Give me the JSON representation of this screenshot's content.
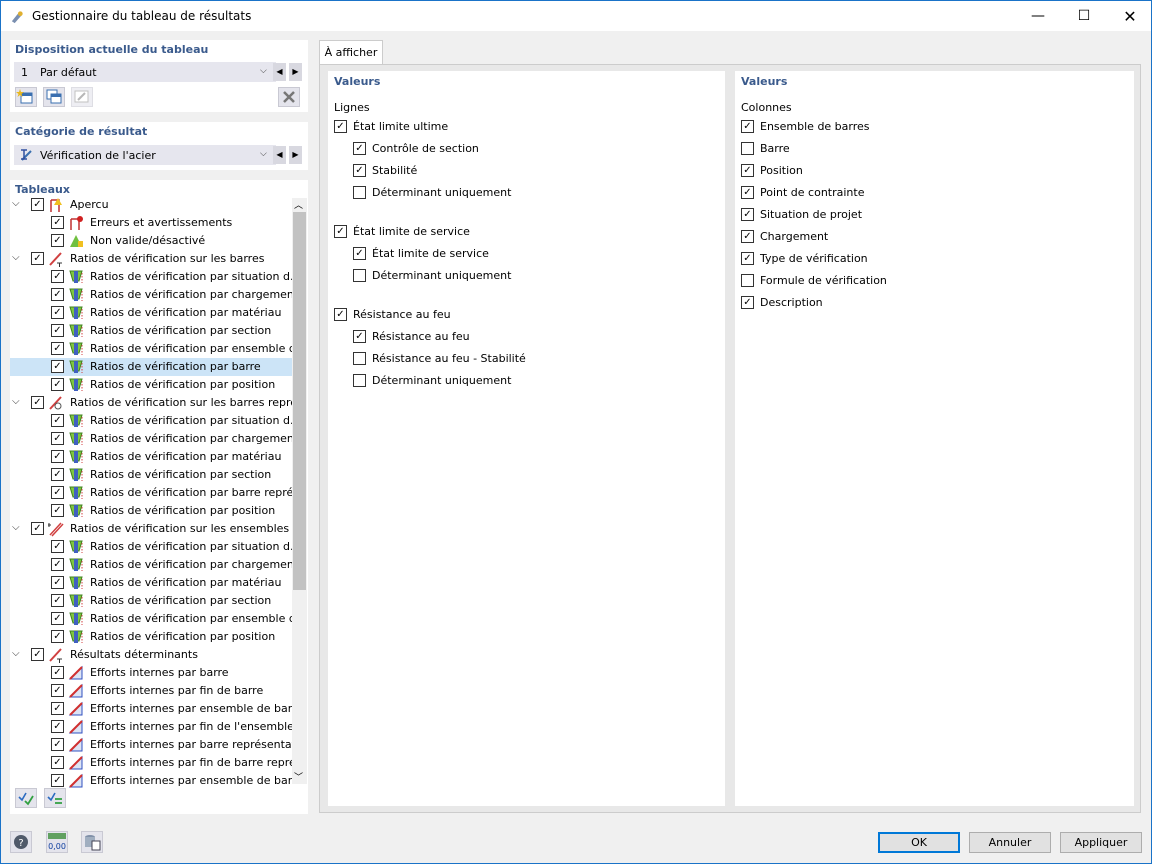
{
  "window": {
    "title": "Gestionnaire du tableau de résultats"
  },
  "layout_panel": {
    "title": "Disposition actuelle du tableau",
    "number": "1",
    "value": "Par défaut"
  },
  "category_panel": {
    "title": "Catégorie de résultat",
    "value": "Vérification de l'acier"
  },
  "tables_panel": {
    "title": "Tableaux",
    "rows": [
      {
        "label": "Apercu",
        "level": 0,
        "expanded": true,
        "checked": true,
        "icon": "overview-icon"
      },
      {
        "label": "Erreurs et avertissements",
        "level": 1,
        "checked": true,
        "icon": "error-icon"
      },
      {
        "label": "Non valide/désactivé",
        "level": 1,
        "checked": true,
        "icon": "warning-icon"
      },
      {
        "label": "Ratios de vérification sur les barres",
        "level": 0,
        "expanded": true,
        "checked": true,
        "icon": "member-icon"
      },
      {
        "label": "Ratios de vérification par situation d...",
        "level": 1,
        "checked": true,
        "icon": "ratio-icon"
      },
      {
        "label": "Ratios de vérification par chargement",
        "level": 1,
        "checked": true,
        "icon": "ratio-icon"
      },
      {
        "label": "Ratios de vérification par matériau",
        "level": 1,
        "checked": true,
        "icon": "ratio-icon"
      },
      {
        "label": "Ratios de vérification par section",
        "level": 1,
        "checked": true,
        "icon": "ratio-icon"
      },
      {
        "label": "Ratios de vérification par ensemble d...",
        "level": 1,
        "checked": true,
        "icon": "ratio-icon"
      },
      {
        "label": "Ratios de vérification par barre",
        "level": 1,
        "checked": true,
        "icon": "ratio-icon",
        "selected": true
      },
      {
        "label": "Ratios de vérification par position",
        "level": 1,
        "checked": true,
        "icon": "ratio-icon"
      },
      {
        "label": "Ratios de vérification sur les barres repré...",
        "level": 0,
        "expanded": true,
        "checked": true,
        "icon": "rep-member-icon"
      },
      {
        "label": "Ratios de vérification par situation d...",
        "level": 1,
        "checked": true,
        "icon": "ratio-icon"
      },
      {
        "label": "Ratios de vérification par chargement",
        "level": 1,
        "checked": true,
        "icon": "ratio-icon"
      },
      {
        "label": "Ratios de vérification par matériau",
        "level": 1,
        "checked": true,
        "icon": "ratio-icon"
      },
      {
        "label": "Ratios de vérification par section",
        "level": 1,
        "checked": true,
        "icon": "ratio-icon"
      },
      {
        "label": "Ratios de vérification par barre repré...",
        "level": 1,
        "checked": true,
        "icon": "ratio-icon"
      },
      {
        "label": "Ratios de vérification par position",
        "level": 1,
        "checked": true,
        "icon": "ratio-icon"
      },
      {
        "label": "Ratios de vérification sur les ensembles d...",
        "level": 0,
        "expanded": true,
        "checked": true,
        "icon": "member-set-icon"
      },
      {
        "label": "Ratios de vérification par situation d...",
        "level": 1,
        "checked": true,
        "icon": "ratio-icon"
      },
      {
        "label": "Ratios de vérification par chargement",
        "level": 1,
        "checked": true,
        "icon": "ratio-icon"
      },
      {
        "label": "Ratios de vérification par matériau",
        "level": 1,
        "checked": true,
        "icon": "ratio-icon"
      },
      {
        "label": "Ratios de vérification par section",
        "level": 1,
        "checked": true,
        "icon": "ratio-icon"
      },
      {
        "label": "Ratios de vérification par ensemble d...",
        "level": 1,
        "checked": true,
        "icon": "ratio-icon"
      },
      {
        "label": "Ratios de vérification par position",
        "level": 1,
        "checked": true,
        "icon": "ratio-icon"
      },
      {
        "label": "Résultats déterminants",
        "level": 0,
        "expanded": true,
        "checked": true,
        "icon": "member-icon"
      },
      {
        "label": "Efforts internes par barre",
        "level": 1,
        "checked": true,
        "icon": "internal-forces-icon"
      },
      {
        "label": "Efforts internes par fin de barre",
        "level": 1,
        "checked": true,
        "icon": "internal-forces-icon"
      },
      {
        "label": "Efforts internes par ensemble de barr...",
        "level": 1,
        "checked": true,
        "icon": "internal-forces-icon"
      },
      {
        "label": "Efforts internes par fin de l'ensemble...",
        "level": 1,
        "checked": true,
        "icon": "internal-forces-icon"
      },
      {
        "label": "Efforts internes par barre représentat...",
        "level": 1,
        "checked": true,
        "icon": "internal-forces-icon"
      },
      {
        "label": "Efforts internes par fin de barre repré...",
        "level": 1,
        "checked": true,
        "icon": "internal-forces-icon"
      },
      {
        "label": "Efforts internes par ensemble de barr...",
        "level": 1,
        "checked": true,
        "icon": "internal-forces-icon"
      }
    ]
  },
  "tab": {
    "label": "À afficher"
  },
  "left_values": {
    "title": "Valeurs",
    "subtitle": "Lignes",
    "groups": [
      {
        "label": "État limite ultime",
        "checked": true,
        "children": [
          {
            "label": "Contrôle de section",
            "checked": true
          },
          {
            "label": "Stabilité",
            "checked": true
          },
          {
            "label": "Déterminant uniquement",
            "checked": false
          }
        ]
      },
      {
        "label": "État limite de service",
        "checked": true,
        "children": [
          {
            "label": "État limite de service",
            "checked": true
          },
          {
            "label": "Déterminant uniquement",
            "checked": false
          }
        ]
      },
      {
        "label": "Résistance au feu",
        "checked": true,
        "children": [
          {
            "label": "Résistance au feu",
            "checked": true
          },
          {
            "label": "Résistance au feu - Stabilité",
            "checked": false
          },
          {
            "label": "Déterminant uniquement",
            "checked": false
          }
        ]
      }
    ]
  },
  "right_values": {
    "title": "Valeurs",
    "subtitle": "Colonnes",
    "items": [
      {
        "label": "Ensemble de barres",
        "checked": true
      },
      {
        "label": "Barre",
        "checked": false
      },
      {
        "label": "Position",
        "checked": true
      },
      {
        "label": "Point de contrainte",
        "checked": true
      },
      {
        "label": "Situation de projet",
        "checked": true
      },
      {
        "label": "Chargement",
        "checked": true
      },
      {
        "label": "Type de vérification",
        "checked": true
      },
      {
        "label": "Formule de vérification",
        "checked": false
      },
      {
        "label": "Description",
        "checked": true
      }
    ]
  },
  "footer": {
    "ok": "OK",
    "cancel": "Annuler",
    "apply": "Appliquer",
    "units_icon_text": "0,00"
  },
  "colors": {
    "accent": "#0078d7",
    "panel_title": "#3a5a8c",
    "selection": "#cce4f7"
  }
}
